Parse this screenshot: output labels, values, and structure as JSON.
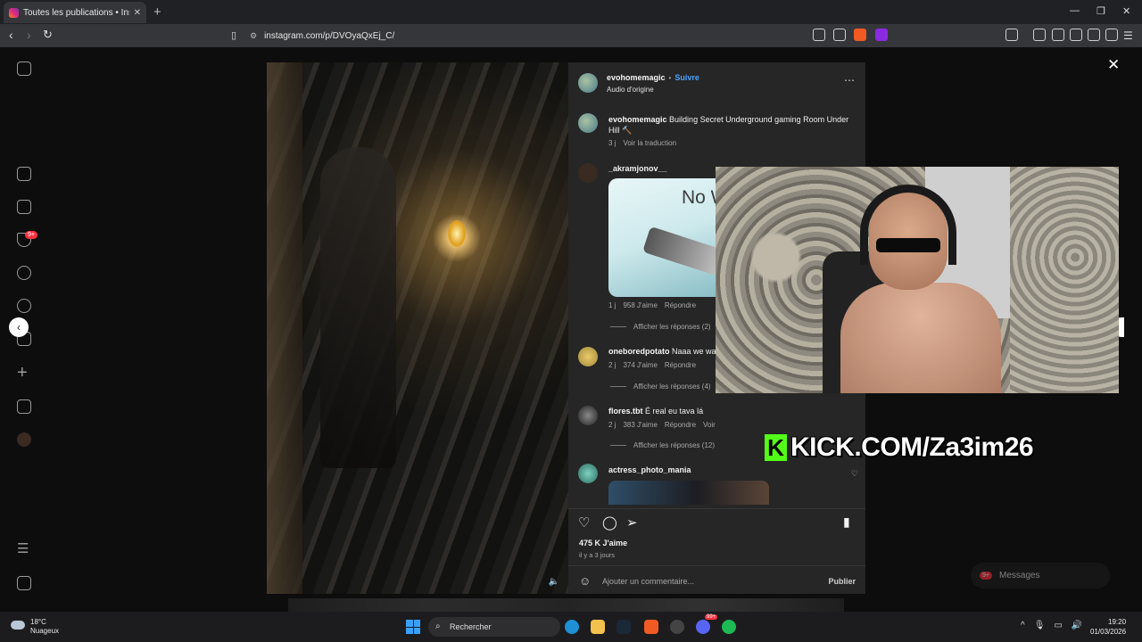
{
  "browser": {
    "tab_title": "Toutes les publications • Insta",
    "url": "instagram.com/p/DVOyaQxEj_C/"
  },
  "sidebar": {
    "notifications_badge": "9+"
  },
  "post": {
    "author": "evohomemagic",
    "separator": "•",
    "follow_label": "Suivre",
    "audio": "Audio d'origine",
    "caption_author": "evohomemagic",
    "caption_text": "Building Secret Underground gaming Room Under Hill 🔨",
    "caption_age": "3 j",
    "see_translation": "Voir la traduction",
    "likes": "475 K J'aime",
    "date": "il y a 3 jours",
    "comment_placeholder": "Ajouter un commentaire...",
    "publish": "Publier"
  },
  "comments": [
    {
      "user": "_akramjonov__",
      "text": "",
      "image_text": "No Wifi",
      "age": "1 j",
      "likes": "958 J'aime",
      "reply": "Répondre",
      "show_replies": "Afficher les réponses (2)"
    },
    {
      "user": "oneboredpotato",
      "text": "Naaa we wa",
      "age": "2 j",
      "likes": "374 J'aime",
      "reply": "Répondre",
      "show_replies": "Afficher les réponses (4)"
    },
    {
      "user": "flores.tbt",
      "text": "É real eu tava lá",
      "age": "2 j",
      "likes": "383 J'aime",
      "reply": "Répondre",
      "extra": "Voir",
      "show_replies": "Afficher les réponses (12)"
    },
    {
      "user": "actress_photo_mania",
      "text": ""
    }
  ],
  "overlay": {
    "kick_logo": "K",
    "kick_text": "KICK.COM/Za3im26"
  },
  "messages": {
    "label": "Messages",
    "badge": "9+"
  },
  "taskbar": {
    "temperature": "18°C",
    "weather": "Nuageux",
    "search_label": "Rechercher",
    "time": "19:20",
    "date": "01/03/2026",
    "discord_badge": "99+"
  },
  "icons": [
    "instagram-icon",
    "home-icon",
    "reels-icon",
    "messages-icon",
    "search-icon",
    "explore-icon",
    "notifications-icon",
    "create-icon",
    "dashboard-icon",
    "profile-icon",
    "more-icon",
    "meta-apps-icon",
    "like-icon",
    "comment-icon",
    "share-icon",
    "bookmark-icon",
    "emoji-icon",
    "close-icon",
    "chevron-left-icon",
    "chevron-right-icon",
    "volume-icon"
  ],
  "colors": {
    "accent": "#4aa3ff",
    "kick_green": "#53fc18",
    "badge": "#ff3040"
  }
}
